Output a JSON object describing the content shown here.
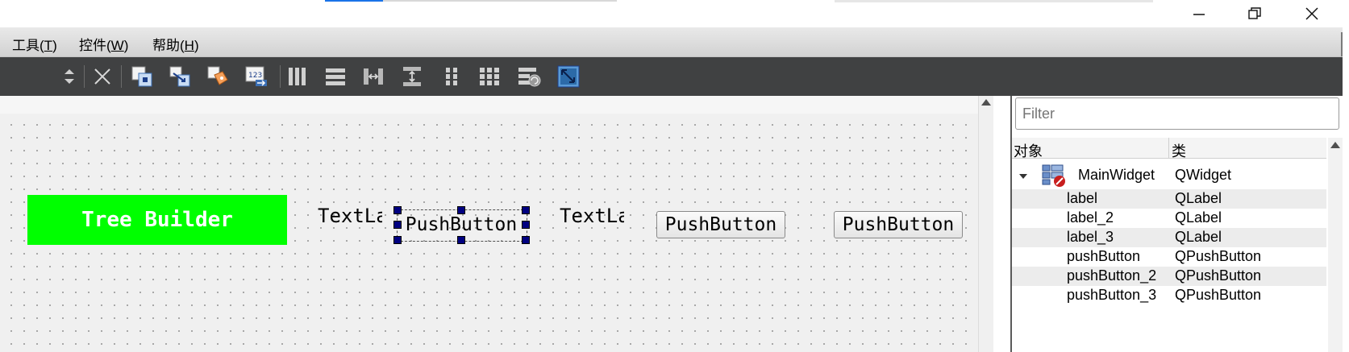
{
  "window": {
    "controls": [
      "minimize-icon",
      "restore-icon",
      "close-icon"
    ]
  },
  "menu": [
    {
      "label": "工具(",
      "hotkey": "T",
      "tail": ")"
    },
    {
      "label": "控件(",
      "hotkey": "W",
      "tail": ")"
    },
    {
      "label": "帮助(",
      "hotkey": "H",
      "tail": ")"
    }
  ],
  "toolbar": {
    "icons": [
      "sort-arrows-icon",
      "close-x-icon",
      "edit-widgets-icon",
      "edit-signals-slots-icon",
      "edit-buddies-icon",
      "edit-tab-order-icon",
      "layout-horizontal-icon",
      "layout-vertical-icon",
      "layout-h-splitter-icon",
      "layout-v-splitter-icon",
      "layout-form-icon",
      "layout-grid-icon",
      "break-layout-icon",
      "adjust-size-icon"
    ]
  },
  "form": {
    "title_label": "Tree Builder",
    "title_bg": "#00ff00",
    "text_label_1": "TextLa",
    "text_label_2": "TextLa",
    "push_button_1": "PushButton",
    "push_button_2": "PushButton",
    "push_button_3": "PushButton"
  },
  "object_inspector": {
    "filter_placeholder": "Filter",
    "col_object": "对象",
    "col_class": "类",
    "root": {
      "name": "MainWidget",
      "class": "QWidget"
    },
    "children": [
      {
        "name": "label",
        "class": "QLabel"
      },
      {
        "name": "label_2",
        "class": "QLabel"
      },
      {
        "name": "label_3",
        "class": "QLabel"
      },
      {
        "name": "pushButton",
        "class": "QPushButton"
      },
      {
        "name": "pushButton_2",
        "class": "QPushButton"
      },
      {
        "name": "pushButton_3",
        "class": "QPushButton"
      }
    ]
  }
}
